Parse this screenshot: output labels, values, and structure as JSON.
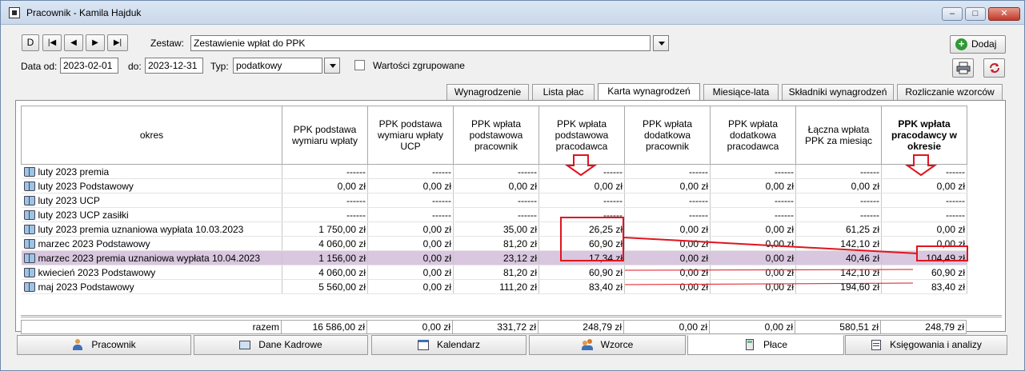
{
  "window": {
    "title": "Pracownik - Kamila Hajduk"
  },
  "toolbar": {
    "nav": [
      "D",
      "|◀",
      "◀",
      "▶",
      "▶|"
    ],
    "zestaw_label": "Zestaw:",
    "zestaw_value": "Zestawienie wpłat do PPK",
    "data_od_label": "Data od:",
    "data_od_value": "2023-02-01",
    "do_label": "do:",
    "do_value": "2023-12-31",
    "typ_label": "Typ:",
    "typ_value": "podatkowy",
    "grouped_label": "Wartości zgrupowane",
    "add_label": "Dodaj"
  },
  "tabs": [
    "Wynagrodzenie",
    "Lista płac",
    "Karta wynagrodzeń",
    "Miesiące-lata",
    "Składniki wynagrodzeń",
    "Rozliczanie wzorców"
  ],
  "active_tab": "Karta wynagrodzeń",
  "grid": {
    "columns": [
      "okres",
      "PPK podstawa wymiaru wpłaty",
      "PPK podstawa wymiaru wpłaty UCP",
      "PPK wpłata podstawowa pracownik",
      "PPK wpłata podstawowa pracodawca",
      "PPK wpłata dodatkowa pracownik",
      "PPK wpłata dodatkowa pracodawca",
      "Łączna wpłata PPK za miesiąc",
      "PPK wpłata pracodawcy w okresie"
    ],
    "rows": [
      [
        "luty 2023 premia",
        "------",
        "------",
        "------",
        "------",
        "------",
        "------",
        "------",
        "------"
      ],
      [
        "luty 2023 Podstawowy",
        "0,00 zł",
        "0,00 zł",
        "0,00 zł",
        "0,00 zł",
        "0,00 zł",
        "0,00 zł",
        "0,00 zł",
        "0,00 zł"
      ],
      [
        "luty 2023 UCP",
        "------",
        "------",
        "------",
        "------",
        "------",
        "------",
        "------",
        "------"
      ],
      [
        "luty 2023 UCP zasiłki",
        "------",
        "------",
        "------",
        "------",
        "------",
        "------",
        "------",
        "------"
      ],
      [
        "luty 2023 premia uznaniowa wypłata 10.03.2023",
        "1 750,00 zł",
        "0,00 zł",
        "35,00 zł",
        "26,25 zł",
        "0,00 zł",
        "0,00 zł",
        "61,25 zł",
        "0,00 zł"
      ],
      [
        "marzec 2023 Podstawowy",
        "4 060,00 zł",
        "0,00 zł",
        "81,20 zł",
        "60,90 zł",
        "0,00 zł",
        "0,00 zł",
        "142,10 zł",
        "0,00 zł"
      ],
      [
        "marzec 2023 premia uznaniowa wypłata 10.04.2023",
        "1 156,00 zł",
        "0,00 zł",
        "23,12 zł",
        "17,34 zł",
        "0,00 zł",
        "0,00 zł",
        "40,46 zł",
        "104,49 zł"
      ],
      [
        "kwiecień 2023 Podstawowy",
        "4 060,00 zł",
        "0,00 zł",
        "81,20 zł",
        "60,90 zł",
        "0,00 zł",
        "0,00 zł",
        "142,10 zł",
        "60,90 zł"
      ],
      [
        "maj 2023 Podstawowy",
        "5 560,00 zł",
        "0,00 zł",
        "111,20 zł",
        "83,40 zł",
        "0,00 zł",
        "0,00 zł",
        "194,60 zł",
        "83,40 zł"
      ]
    ],
    "selected_row": 6,
    "summary": [
      "razem",
      "16 586,00 zł",
      "0,00 zł",
      "331,72 zł",
      "248,79 zł",
      "0,00 zł",
      "0,00 zł",
      "580,51 zł",
      "248,79 zł"
    ]
  },
  "bottom_tabs": [
    "Pracownik",
    "Dane Kadrowe",
    "Kalendarz",
    "Wzorce",
    "Płace",
    "Księgowania i analizy"
  ],
  "active_bottom_tab": "Płace",
  "colors": {
    "highlight": "#d8c7df",
    "annotation": "#e0141e",
    "accent": "#2a8a2a"
  }
}
